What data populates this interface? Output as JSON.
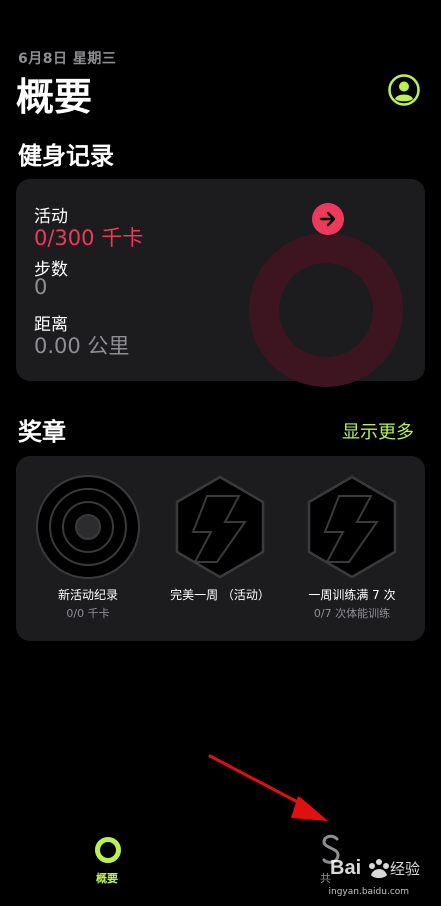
{
  "header": {
    "date": "6月8日 星期三",
    "title": "概要"
  },
  "fitness": {
    "section_title": "健身记录",
    "activity_label": "活动",
    "activity_value": "0/300 千卡",
    "steps_label": "步数",
    "steps_value": "0",
    "distance_label": "距离",
    "distance_value": "0.00 公里",
    "activity_progress": 0,
    "ring_color": "#ea3b5c"
  },
  "awards": {
    "section_title": "奖章",
    "more_label": "显示更多",
    "items": [
      {
        "name": "新活动纪录",
        "sub": "0/0 千卡",
        "icon": "target-badge-icon"
      },
      {
        "name": "完美一周 （活动）",
        "sub": "",
        "icon": "hexagon-badge-icon"
      },
      {
        "name": "一周训练满 7 次",
        "sub": "0/7 次体能训练",
        "icon": "hexagon-badge-icon"
      }
    ]
  },
  "tabbar": {
    "summary_label": "概要",
    "share_label": "共"
  },
  "colors": {
    "accent": "#b9f250",
    "activity_red": "#ea3b5c",
    "card_bg": "#1c1c1e"
  }
}
